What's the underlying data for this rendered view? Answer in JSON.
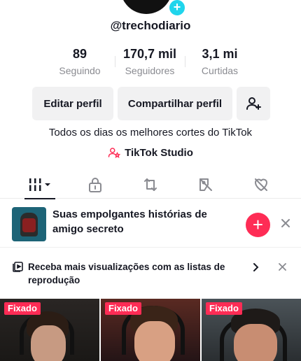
{
  "profile": {
    "username": "@trechodiario",
    "bio": "Todos os dias os melhores cortes do TikTok",
    "studio_label": "TikTok Studio"
  },
  "stats": [
    {
      "value": "89",
      "label": "Seguindo"
    },
    {
      "value": "170,7 mil",
      "label": "Seguidores"
    },
    {
      "value": "3,1 mi",
      "label": "Curtidas"
    }
  ],
  "actions": {
    "edit_label": "Editar perfil",
    "share_label": "Compartilhar perfil"
  },
  "tabs": [
    {
      "icon": "grid-videos-icon",
      "active": true
    },
    {
      "icon": "lock-icon",
      "active": false
    },
    {
      "icon": "repost-icon",
      "active": false
    },
    {
      "icon": "tagged-icon",
      "active": false
    },
    {
      "icon": "liked-icon",
      "active": false
    }
  ],
  "promo": {
    "text": "Suas empolgantes histórias de amigo secreto"
  },
  "playlist_banner": {
    "text": "Receba mais visualizações com as listas de reprodução"
  },
  "videos": [
    {
      "badge": "Fixado"
    },
    {
      "badge": "Fixado"
    },
    {
      "badge": "Fixado"
    }
  ],
  "colors": {
    "accent": "#fe2c55",
    "avatar_plus": "#20d5ec",
    "text": "#161823",
    "muted": "#8a8b91",
    "button_bg": "#f1f1f2"
  }
}
